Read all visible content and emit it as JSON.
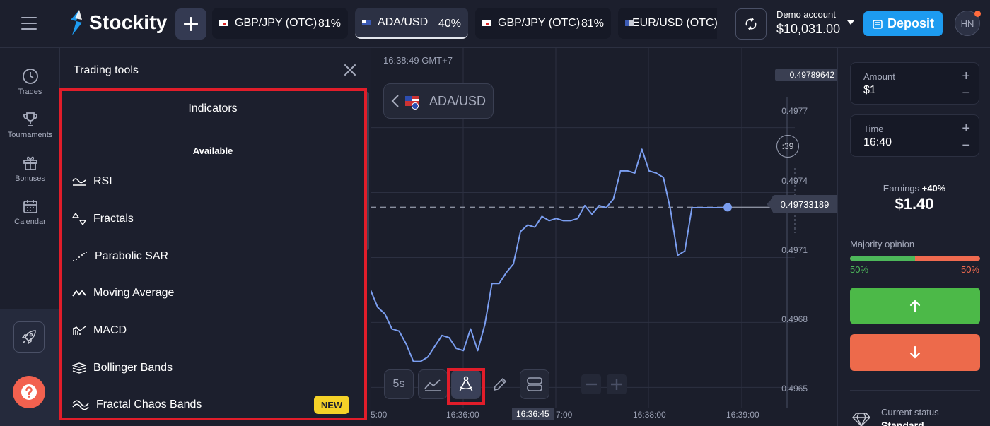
{
  "header": {
    "brand": "Stockity",
    "tabs": [
      {
        "name": "GBP/JPY (OTC)",
        "percent": "81%",
        "active": false
      },
      {
        "name": "ADA/USD",
        "percent": "40%",
        "active": true
      },
      {
        "name": "GBP/JPY (OTC)",
        "percent": "81%",
        "active": false
      },
      {
        "name": "EUR/USD (OTC)",
        "percent": "",
        "active": false
      }
    ],
    "account_label": "Demo account",
    "balance": "$10,031.00",
    "deposit_label": "Deposit",
    "avatar_initials": "HN"
  },
  "sidebar": {
    "items": [
      {
        "label": "Trades",
        "icon": "clock-icon"
      },
      {
        "label": "Tournaments",
        "icon": "trophy-icon"
      },
      {
        "label": "Bonuses",
        "icon": "gift-icon"
      },
      {
        "label": "Calendar",
        "icon": "calendar-icon"
      }
    ]
  },
  "tools_panel": {
    "title": "Trading tools",
    "section_tab": "Indicators",
    "available_label": "Available",
    "indicators": [
      {
        "label": "RSI",
        "icon": "rsi-icon"
      },
      {
        "label": "Fractals",
        "icon": "fractals-icon"
      },
      {
        "label": "Parabolic SAR",
        "icon": "parabolic-sar-icon"
      },
      {
        "label": "Moving Average",
        "icon": "moving-average-icon"
      },
      {
        "label": "MACD",
        "icon": "macd-icon"
      },
      {
        "label": "Bollinger Bands",
        "icon": "bollinger-bands-icon"
      },
      {
        "label": "Fractal Chaos Bands",
        "icon": "fractal-chaos-bands-icon",
        "badge": "NEW"
      }
    ]
  },
  "chart": {
    "clock": "16:38:49 GMT+7",
    "asset": "ADA/USD",
    "timer": ":39",
    "current_price": "0.49733189",
    "top_price": "0.49789642",
    "timeframe_label": "5s",
    "y_ticks": [
      "0.4977",
      "0.4974",
      "0.4971",
      "0.4968",
      "0.4965"
    ],
    "x_ticks": [
      "5:00",
      "16:36:00",
      "16:36:45",
      "7:00",
      "16:38:00",
      "16:39:00"
    ],
    "highlighted_x_tick": "16:36:45"
  },
  "chart_data": {
    "type": "line",
    "series": [
      {
        "x": [
          0,
          10,
          20,
          30,
          40,
          50,
          60,
          70,
          80,
          90,
          100,
          110,
          120,
          130,
          140,
          150,
          160,
          170,
          180,
          190,
          200,
          210,
          220,
          230,
          240,
          250,
          260,
          270,
          280,
          290,
          300,
          310,
          320,
          330,
          340,
          350,
          360,
          370,
          380,
          390,
          400,
          410,
          420,
          430,
          440,
          450,
          460,
          470,
          480,
          490,
          500
        ],
        "y": [
          0.49695,
          0.49687,
          0.49684,
          0.49677,
          0.49676,
          0.4967,
          0.49662,
          0.49662,
          0.49664,
          0.49669,
          0.49674,
          0.49673,
          0.49668,
          0.49667,
          0.49677,
          0.49667,
          0.49679,
          0.49698,
          0.49698,
          0.49703,
          0.49707,
          0.49722,
          0.49725,
          0.49724,
          0.49729,
          0.49727,
          0.49728,
          0.49727,
          0.49727,
          0.49728,
          0.49734,
          0.4973,
          0.49734,
          0.49733,
          0.49737,
          0.4975,
          0.4975,
          0.49749,
          0.4976,
          0.4975,
          0.49749,
          0.49747,
          0.49732,
          0.49711,
          0.49713,
          0.49733,
          0.49733,
          0.49733,
          0.49733,
          0.49733,
          0.49733
        ]
      }
    ],
    "ylim": [
      0.4964,
      0.49795
    ],
    "current_value": 0.49733189
  },
  "trade_panel": {
    "amount_label": "Amount",
    "amount_value": "$1",
    "time_label": "Time",
    "time_value": "16:40",
    "earnings_label": "Earnings",
    "earnings_pct": "+40%",
    "earnings_value": "$1.40",
    "majority_label": "Majority opinion",
    "majority_up": "50%",
    "majority_down": "50%",
    "majority_up_fraction": 0.5,
    "status_label": "Current status",
    "status_value": "Standard"
  },
  "colors": {
    "background": "#1c1f2d",
    "accent_blue": "#1d9bf0",
    "up_green": "#4cb948",
    "down_red": "#ed6a4b",
    "highlight_red": "#e11d2a",
    "line_blue": "#7b9ef0",
    "badge_yellow": "#f5d228"
  }
}
